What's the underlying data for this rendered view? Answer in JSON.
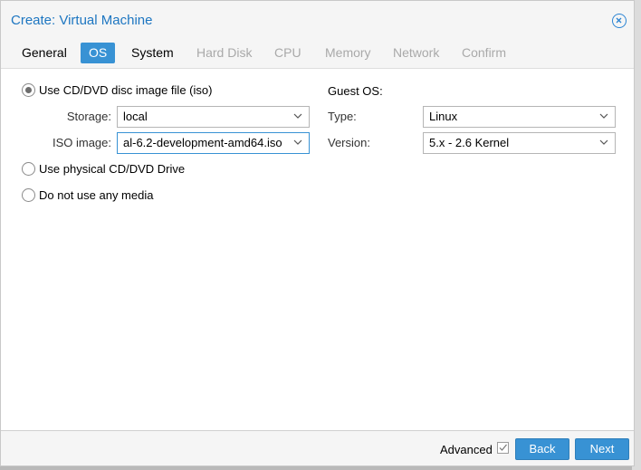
{
  "dialog": {
    "title": "Create: Virtual Machine",
    "close_icon": "close-circle-icon"
  },
  "tabs": [
    {
      "label": "General",
      "state": "normal"
    },
    {
      "label": "OS",
      "state": "active"
    },
    {
      "label": "System",
      "state": "normal"
    },
    {
      "label": "Hard Disk",
      "state": "disabled"
    },
    {
      "label": "CPU",
      "state": "disabled"
    },
    {
      "label": "Memory",
      "state": "disabled"
    },
    {
      "label": "Network",
      "state": "disabled"
    },
    {
      "label": "Confirm",
      "state": "disabled"
    }
  ],
  "media": {
    "iso_option": {
      "label": "Use CD/DVD disc image file (iso)",
      "checked": true
    },
    "storage": {
      "label": "Storage:",
      "value": "local"
    },
    "iso_image": {
      "label": "ISO image:",
      "value": "al-6.2-development-amd64.iso"
    },
    "physical_option": {
      "label": "Use physical CD/DVD Drive",
      "checked": false
    },
    "none_option": {
      "label": "Do not use any media",
      "checked": false
    }
  },
  "guest_os": {
    "heading": "Guest OS:",
    "type": {
      "label": "Type:",
      "value": "Linux"
    },
    "version": {
      "label": "Version:",
      "value": "5.x - 2.6 Kernel"
    }
  },
  "footer": {
    "advanced_label": "Advanced",
    "advanced_checked": true,
    "back_label": "Back",
    "next_label": "Next"
  },
  "colors": {
    "accent": "#3892d4",
    "title": "#1d76c1",
    "disabled_tab": "#a9a9a9"
  }
}
